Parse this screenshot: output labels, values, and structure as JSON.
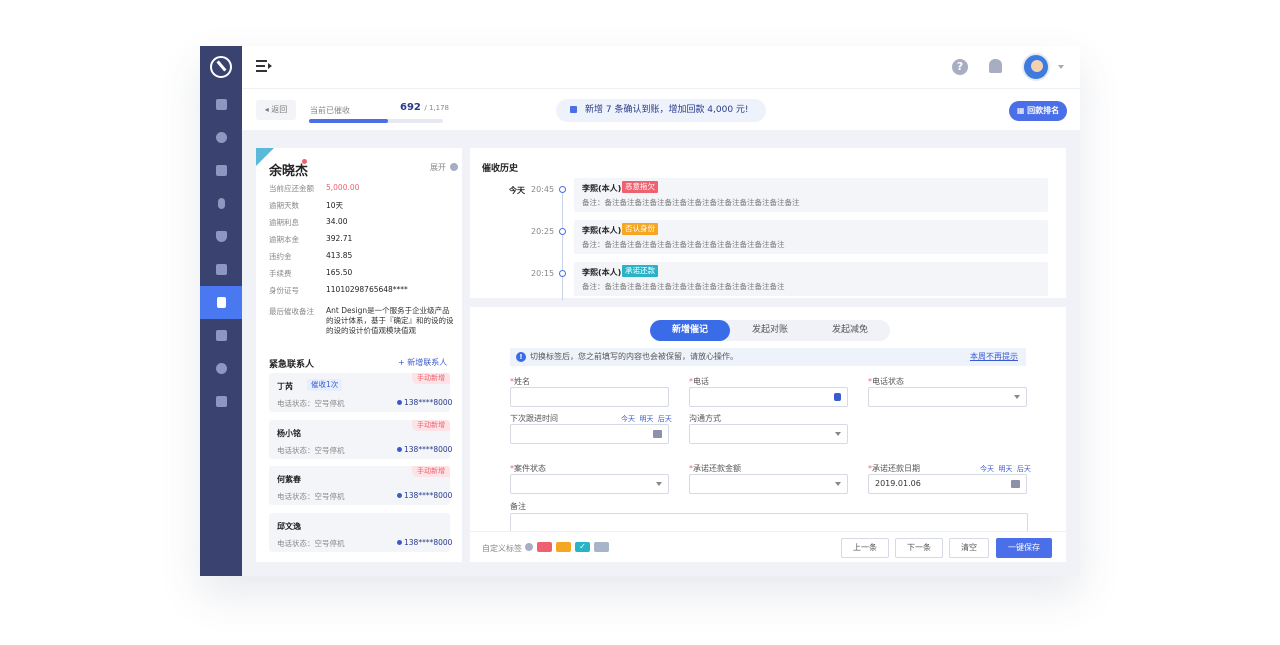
{
  "topbar": {
    "help_glyph": "?"
  },
  "subbar": {
    "back_label": "返回",
    "progress_label": "当前已催收",
    "progress_value": "692",
    "progress_total": "/ 1,178",
    "progress_fraction": 0.59,
    "notice": "新增 7 条确认到账，增加回款 4,000 元!",
    "rank_label": "回款排名"
  },
  "customer": {
    "name": "余晓杰",
    "expand_label": "展开",
    "fields": [
      {
        "label": "当前应还金额",
        "value": "5,000.00",
        "highlight": true
      },
      {
        "label": "逾期天数",
        "value": "10天",
        "highlight": false
      },
      {
        "label": "逾期利息",
        "value": "34.00",
        "highlight": false
      },
      {
        "label": "逾期本金",
        "value": "392.71",
        "highlight": false
      },
      {
        "label": "违约金",
        "value": "413.85",
        "highlight": false
      },
      {
        "label": "手续费",
        "value": "165.50",
        "highlight": false
      },
      {
        "label": "身份证号",
        "value": "11010298765648****",
        "highlight": false
      }
    ],
    "note_label": "最后催收备注",
    "note_value": "Ant Design是一个服务于企业级产品的设计体系，基于『确定』和的设的设的设的设计价值观模块值观"
  },
  "contacts": {
    "title": "紧急联系人",
    "add_label": "+ 新增联系人",
    "items": [
      {
        "name": "丁芮",
        "badge": "催收1次",
        "tag": "手动新增",
        "status": "电话状态：空号停机",
        "phone": "138****8000"
      },
      {
        "name": "杨小铭",
        "badge": "",
        "tag": "手动新增",
        "status": "电话状态：空号停机",
        "phone": "138****8000"
      },
      {
        "name": "何紫春",
        "badge": "",
        "tag": "手动新增",
        "status": "电话状态：空号停机",
        "phone": "138****8000"
      },
      {
        "name": "邱文逸",
        "badge": "",
        "tag": "",
        "status": "电话状态：空号停机",
        "phone": "138****8000"
      }
    ]
  },
  "history": {
    "title": "催收历史",
    "entries": [
      {
        "day": "今天",
        "time": "20:45",
        "person": "李熙(本人)",
        "tag": "恶意拖欠",
        "tag_color": "#f0616f",
        "note": "备注：备注备注备注备注备注备注备注备注备注备注备注备注备注"
      },
      {
        "day": "",
        "time": "20:25",
        "person": "李熙(本人)",
        "tag": "否认身份",
        "tag_color": "#f5a623",
        "note": "备注：备注备注备注备注备注备注备注备注备注备注备注备注"
      },
      {
        "day": "",
        "time": "20:15",
        "person": "李熙(本人)",
        "tag": "承诺还款",
        "tag_color": "#29b3c7",
        "note": "备注：备注备注备注备注备注备注备注备注备注备注备注备注"
      }
    ]
  },
  "form": {
    "tabs": [
      "新增催记",
      "发起对账",
      "发起减免"
    ],
    "tip": "切换标签后，您之前填写的内容也会被保留，请放心操作。",
    "tip_icon_glyph": "!",
    "tip_link": "本周不再提示",
    "fields": {
      "name": "姓名",
      "phone": "电话",
      "phone_status": "电话状态",
      "next_time": "下次跟进时间",
      "contact_method": "沟通方式",
      "case_status": "案件状态",
      "promise_amount": "承诺还款金额",
      "promise_date": "承诺还款日期",
      "promise_date_value": "2019.01.06",
      "remark": "备注"
    },
    "quick": {
      "today": "今天",
      "tomorrow": "明天",
      "after": "后天"
    },
    "footer": {
      "tags_label": "自定义标签",
      "swatches": [
        "#f0616f",
        "#f5a623",
        "#29b3c7",
        "#a8b4c8"
      ],
      "check_glyph": "✓",
      "prev": "上一条",
      "next": "下一条",
      "clear": "清空",
      "save": "一键保存"
    }
  }
}
